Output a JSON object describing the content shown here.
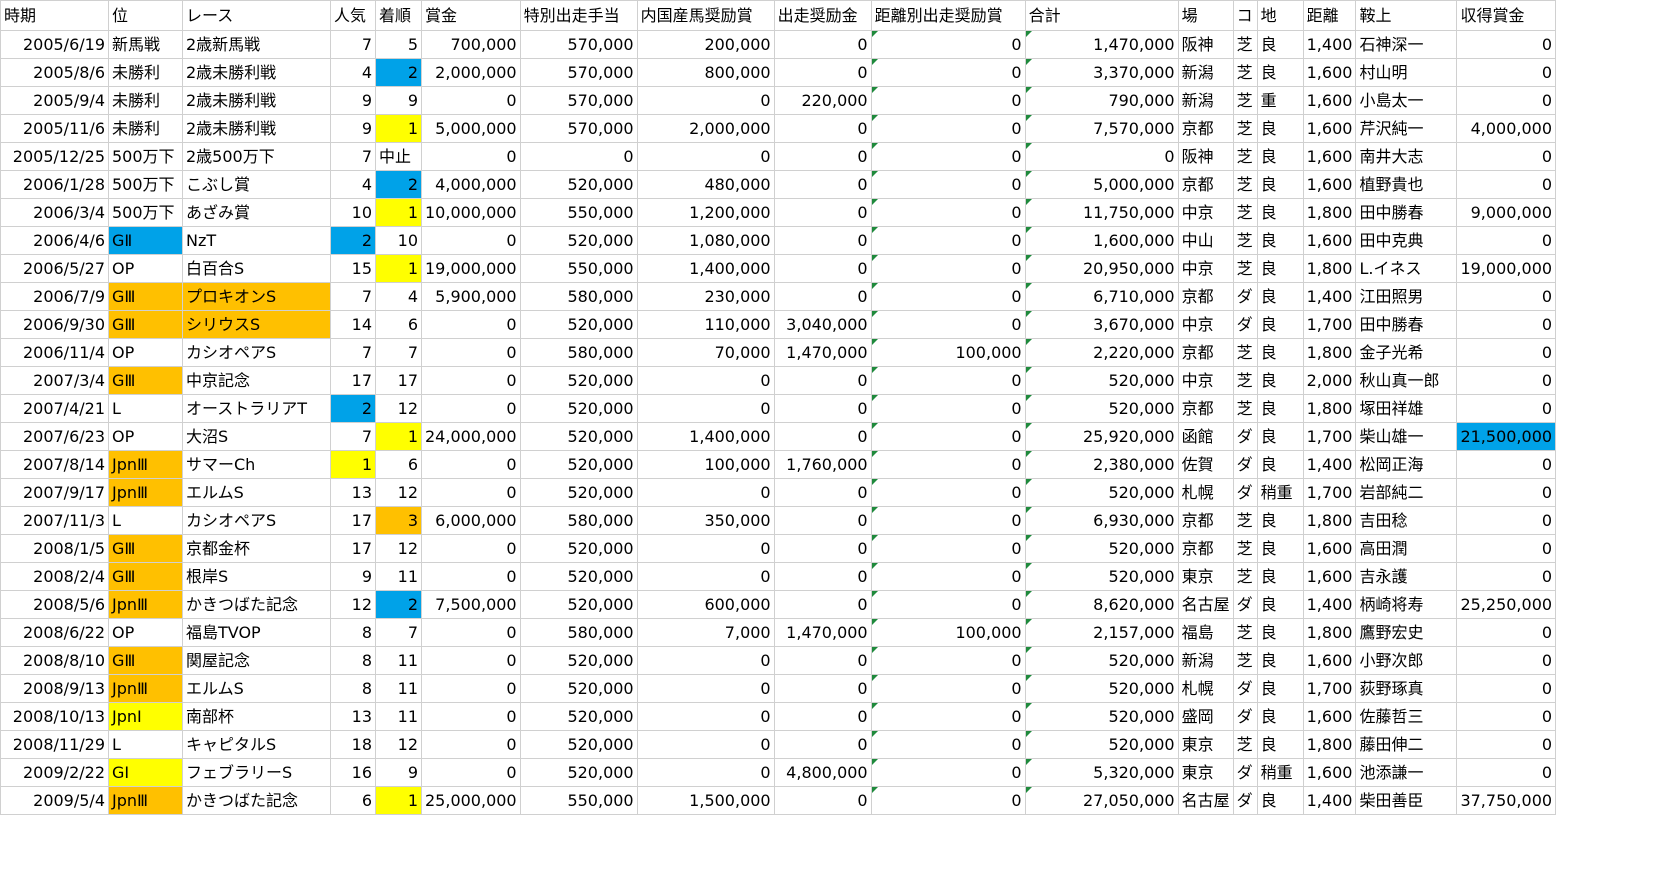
{
  "colors": {
    "blue": "#00a2e8",
    "yellow": "#ffff00",
    "orange": "#ffc000",
    "grid": "#d0d0d0"
  },
  "headers": [
    "時期",
    "位",
    "レース",
    "人気",
    "着順",
    "賞金",
    "特別出走手当",
    "内国産馬奨励賞",
    "出走奨励金",
    "距離別出走奨励賞",
    "合計",
    "場",
    "コ",
    "地",
    "距離",
    "鞍上",
    "収得賞金"
  ],
  "rows": [
    {
      "date": "2005/6/19",
      "grade": "新馬戦",
      "race": "2歳新馬戦",
      "pop": "7",
      "place": "5",
      "prize": "700,000",
      "special": "570,000",
      "domestic": "200,000",
      "encourage": "0",
      "distance_award": "0",
      "total": "1,470,000",
      "venue": "阪神",
      "course": "芝",
      "ground": "良",
      "dist": "1,400",
      "jockey": "石神深一",
      "earned": "0"
    },
    {
      "date": "2005/8/6",
      "grade": "未勝利",
      "race": "2歳未勝利戦",
      "pop": "4",
      "place": "2",
      "prize": "2,000,000",
      "special": "570,000",
      "domestic": "800,000",
      "encourage": "0",
      "distance_award": "0",
      "total": "3,370,000",
      "venue": "新潟",
      "course": "芝",
      "ground": "良",
      "dist": "1,600",
      "jockey": "村山明",
      "earned": "0",
      "place_bg": "blue"
    },
    {
      "date": "2005/9/4",
      "grade": "未勝利",
      "race": "2歳未勝利戦",
      "pop": "9",
      "place": "9",
      "prize": "0",
      "special": "570,000",
      "domestic": "0",
      "encourage": "220,000",
      "distance_award": "0",
      "total": "790,000",
      "venue": "新潟",
      "course": "芝",
      "ground": "重",
      "dist": "1,600",
      "jockey": "小島太一",
      "earned": "0"
    },
    {
      "date": "2005/11/6",
      "grade": "未勝利",
      "race": "2歳未勝利戦",
      "pop": "9",
      "place": "1",
      "prize": "5,000,000",
      "special": "570,000",
      "domestic": "2,000,000",
      "encourage": "0",
      "distance_award": "0",
      "total": "7,570,000",
      "venue": "京都",
      "course": "芝",
      "ground": "良",
      "dist": "1,600",
      "jockey": "芹沢純一",
      "earned": "4,000,000",
      "place_bg": "yellow"
    },
    {
      "date": "2005/12/25",
      "grade": "500万下",
      "race": "2歳500万下",
      "pop": "7",
      "place": "中止",
      "prize": "0",
      "special": "0",
      "domestic": "0",
      "encourage": "0",
      "distance_award": "0",
      "total": "0",
      "venue": "阪神",
      "course": "芝",
      "ground": "良",
      "dist": "1,600",
      "jockey": "南井大志",
      "earned": "0",
      "place_align": "l"
    },
    {
      "date": "2006/1/28",
      "grade": "500万下",
      "race": "こぶし賞",
      "pop": "4",
      "place": "2",
      "prize": "4,000,000",
      "special": "520,000",
      "domestic": "480,000",
      "encourage": "0",
      "distance_award": "0",
      "total": "5,000,000",
      "venue": "京都",
      "course": "芝",
      "ground": "良",
      "dist": "1,600",
      "jockey": "植野貴也",
      "earned": "0",
      "place_bg": "blue"
    },
    {
      "date": "2006/3/4",
      "grade": "500万下",
      "race": "あざみ賞",
      "pop": "10",
      "place": "1",
      "prize": "10,000,000",
      "special": "550,000",
      "domestic": "1,200,000",
      "encourage": "0",
      "distance_award": "0",
      "total": "11,750,000",
      "venue": "中京",
      "course": "芝",
      "ground": "良",
      "dist": "1,800",
      "jockey": "田中勝春",
      "earned": "9,000,000",
      "place_bg": "yellow"
    },
    {
      "date": "2006/4/6",
      "grade": "GⅡ",
      "race": "NzT",
      "pop": "2",
      "place": "10",
      "prize": "0",
      "special": "520,000",
      "domestic": "1,080,000",
      "encourage": "0",
      "distance_award": "0",
      "total": "1,600,000",
      "venue": "中山",
      "course": "芝",
      "ground": "良",
      "dist": "1,600",
      "jockey": "田中克典",
      "earned": "0",
      "grade_bg": "blue",
      "pop_bg": "blue"
    },
    {
      "date": "2006/5/27",
      "grade": "OP",
      "race": "白百合S",
      "pop": "15",
      "place": "1",
      "prize": "19,000,000",
      "special": "550,000",
      "domestic": "1,400,000",
      "encourage": "0",
      "distance_award": "0",
      "total": "20,950,000",
      "venue": "中京",
      "course": "芝",
      "ground": "良",
      "dist": "1,800",
      "jockey": "L.イネス",
      "earned": "19,000,000",
      "place_bg": "yellow"
    },
    {
      "date": "2006/7/9",
      "grade": "GⅢ",
      "race": "プロキオンS",
      "pop": "7",
      "place": "4",
      "prize": "5,900,000",
      "special": "580,000",
      "domestic": "230,000",
      "encourage": "0",
      "distance_award": "0",
      "total": "6,710,000",
      "venue": "京都",
      "course": "ダ",
      "ground": "良",
      "dist": "1,400",
      "jockey": "江田照男",
      "earned": "0",
      "grade_bg": "orange",
      "race_bg": "orange"
    },
    {
      "date": "2006/9/30",
      "grade": "GⅢ",
      "race": "シリウスS",
      "pop": "14",
      "place": "6",
      "prize": "0",
      "special": "520,000",
      "domestic": "110,000",
      "encourage": "3,040,000",
      "distance_award": "0",
      "total": "3,670,000",
      "venue": "中京",
      "course": "ダ",
      "ground": "良",
      "dist": "1,700",
      "jockey": "田中勝春",
      "earned": "0",
      "grade_bg": "orange",
      "race_bg": "orange"
    },
    {
      "date": "2006/11/4",
      "grade": "OP",
      "race": "カシオペアS",
      "pop": "7",
      "place": "7",
      "prize": "0",
      "special": "580,000",
      "domestic": "70,000",
      "encourage": "1,470,000",
      "distance_award": "100,000",
      "total": "2,220,000",
      "venue": "京都",
      "course": "芝",
      "ground": "良",
      "dist": "1,800",
      "jockey": "金子光希",
      "earned": "0"
    },
    {
      "date": "2007/3/4",
      "grade": "GⅢ",
      "race": "中京記念",
      "pop": "17",
      "place": "17",
      "prize": "0",
      "special": "520,000",
      "domestic": "0",
      "encourage": "0",
      "distance_award": "0",
      "total": "520,000",
      "venue": "中京",
      "course": "芝",
      "ground": "良",
      "dist": "2,000",
      "jockey": "秋山真一郎",
      "earned": "0",
      "grade_bg": "orange"
    },
    {
      "date": "2007/4/21",
      "grade": "L",
      "race": "オーストラリアT",
      "pop": "2",
      "place": "12",
      "prize": "0",
      "special": "520,000",
      "domestic": "0",
      "encourage": "0",
      "distance_award": "0",
      "total": "520,000",
      "venue": "京都",
      "course": "芝",
      "ground": "良",
      "dist": "1,800",
      "jockey": "塚田祥雄",
      "earned": "0",
      "pop_bg": "blue"
    },
    {
      "date": "2007/6/23",
      "grade": "OP",
      "race": "大沼S",
      "pop": "7",
      "place": "1",
      "prize": "24,000,000",
      "special": "520,000",
      "domestic": "1,400,000",
      "encourage": "0",
      "distance_award": "0",
      "total": "25,920,000",
      "venue": "函館",
      "course": "ダ",
      "ground": "良",
      "dist": "1,700",
      "jockey": "柴山雄一",
      "earned": "21,500,000",
      "place_bg": "yellow",
      "earned_bg": "blue"
    },
    {
      "date": "2007/8/14",
      "grade": "JpnⅢ",
      "race": "サマーCh",
      "pop": "1",
      "place": "6",
      "prize": "0",
      "special": "520,000",
      "domestic": "100,000",
      "encourage": "1,760,000",
      "distance_award": "0",
      "total": "2,380,000",
      "venue": "佐賀",
      "course": "ダ",
      "ground": "良",
      "dist": "1,400",
      "jockey": "松岡正海",
      "earned": "0",
      "grade_bg": "orange",
      "pop_bg": "yellow"
    },
    {
      "date": "2007/9/17",
      "grade": "JpnⅢ",
      "race": "エルムS",
      "pop": "13",
      "place": "12",
      "prize": "0",
      "special": "520,000",
      "domestic": "0",
      "encourage": "0",
      "distance_award": "0",
      "total": "520,000",
      "venue": "札幌",
      "course": "ダ",
      "ground": "稍重",
      "dist": "1,700",
      "jockey": "岩部純二",
      "earned": "0",
      "grade_bg": "orange"
    },
    {
      "date": "2007/11/3",
      "grade": "L",
      "race": "カシオペアS",
      "pop": "17",
      "place": "3",
      "prize": "6,000,000",
      "special": "580,000",
      "domestic": "350,000",
      "encourage": "0",
      "distance_award": "0",
      "total": "6,930,000",
      "venue": "京都",
      "course": "芝",
      "ground": "良",
      "dist": "1,800",
      "jockey": "吉田稔",
      "earned": "0",
      "place_bg": "orange"
    },
    {
      "date": "2008/1/5",
      "grade": "GⅢ",
      "race": "京都金杯",
      "pop": "17",
      "place": "12",
      "prize": "0",
      "special": "520,000",
      "domestic": "0",
      "encourage": "0",
      "distance_award": "0",
      "total": "520,000",
      "venue": "京都",
      "course": "芝",
      "ground": "良",
      "dist": "1,600",
      "jockey": "高田潤",
      "earned": "0",
      "grade_bg": "orange"
    },
    {
      "date": "2008/2/4",
      "grade": "GⅢ",
      "race": "根岸S",
      "pop": "9",
      "place": "11",
      "prize": "0",
      "special": "520,000",
      "domestic": "0",
      "encourage": "0",
      "distance_award": "0",
      "total": "520,000",
      "venue": "東京",
      "course": "芝",
      "ground": "良",
      "dist": "1,600",
      "jockey": "吉永護",
      "earned": "0",
      "grade_bg": "orange"
    },
    {
      "date": "2008/5/6",
      "grade": "JpnⅢ",
      "race": "かきつばた記念",
      "pop": "12",
      "place": "2",
      "prize": "7,500,000",
      "special": "520,000",
      "domestic": "600,000",
      "encourage": "0",
      "distance_award": "0",
      "total": "8,620,000",
      "venue": "名古屋",
      "course": "ダ",
      "ground": "良",
      "dist": "1,400",
      "jockey": "柄崎将寿",
      "earned": "25,250,000",
      "grade_bg": "orange",
      "place_bg": "blue"
    },
    {
      "date": "2008/6/22",
      "grade": "OP",
      "race": "福島TVOP",
      "pop": "8",
      "place": "7",
      "prize": "0",
      "special": "580,000",
      "domestic": "7,000",
      "encourage": "1,470,000",
      "distance_award": "100,000",
      "total": "2,157,000",
      "venue": "福島",
      "course": "芝",
      "ground": "良",
      "dist": "1,800",
      "jockey": "鷹野宏史",
      "earned": "0"
    },
    {
      "date": "2008/8/10",
      "grade": "GⅢ",
      "race": "関屋記念",
      "pop": "8",
      "place": "11",
      "prize": "0",
      "special": "520,000",
      "domestic": "0",
      "encourage": "0",
      "distance_award": "0",
      "total": "520,000",
      "venue": "新潟",
      "course": "芝",
      "ground": "良",
      "dist": "1,600",
      "jockey": "小野次郎",
      "earned": "0",
      "grade_bg": "orange"
    },
    {
      "date": "2008/9/13",
      "grade": "JpnⅢ",
      "race": "エルムS",
      "pop": "8",
      "place": "11",
      "prize": "0",
      "special": "520,000",
      "domestic": "0",
      "encourage": "0",
      "distance_award": "0",
      "total": "520,000",
      "venue": "札幌",
      "course": "ダ",
      "ground": "良",
      "dist": "1,700",
      "jockey": "荻野琢真",
      "earned": "0",
      "grade_bg": "orange"
    },
    {
      "date": "2008/10/13",
      "grade": "JpnⅠ",
      "race": "南部杯",
      "pop": "13",
      "place": "11",
      "prize": "0",
      "special": "520,000",
      "domestic": "0",
      "encourage": "0",
      "distance_award": "0",
      "total": "520,000",
      "venue": "盛岡",
      "course": "ダ",
      "ground": "良",
      "dist": "1,600",
      "jockey": "佐藤哲三",
      "earned": "0",
      "grade_bg": "yellow"
    },
    {
      "date": "2008/11/29",
      "grade": "L",
      "race": "キャピタルS",
      "pop": "18",
      "place": "12",
      "prize": "0",
      "special": "520,000",
      "domestic": "0",
      "encourage": "0",
      "distance_award": "0",
      "total": "520,000",
      "venue": "東京",
      "course": "芝",
      "ground": "良",
      "dist": "1,800",
      "jockey": "藤田伸二",
      "earned": "0"
    },
    {
      "date": "2009/2/22",
      "grade": "GⅠ",
      "race": "フェブラリーS",
      "pop": "16",
      "place": "9",
      "prize": "0",
      "special": "520,000",
      "domestic": "0",
      "encourage": "4,800,000",
      "distance_award": "0",
      "total": "5,320,000",
      "venue": "東京",
      "course": "ダ",
      "ground": "稍重",
      "dist": "1,600",
      "jockey": "池添謙一",
      "earned": "0",
      "grade_bg": "yellow"
    },
    {
      "date": "2009/5/4",
      "grade": "JpnⅢ",
      "race": "かきつばた記念",
      "pop": "6",
      "place": "1",
      "prize": "25,000,000",
      "special": "550,000",
      "domestic": "1,500,000",
      "encourage": "0",
      "distance_award": "0",
      "total": "27,050,000",
      "venue": "名古屋",
      "course": "ダ",
      "ground": "良",
      "dist": "1,400",
      "jockey": "柴田善臣",
      "earned": "37,750,000",
      "grade_bg": "orange",
      "place_bg": "yellow"
    }
  ]
}
